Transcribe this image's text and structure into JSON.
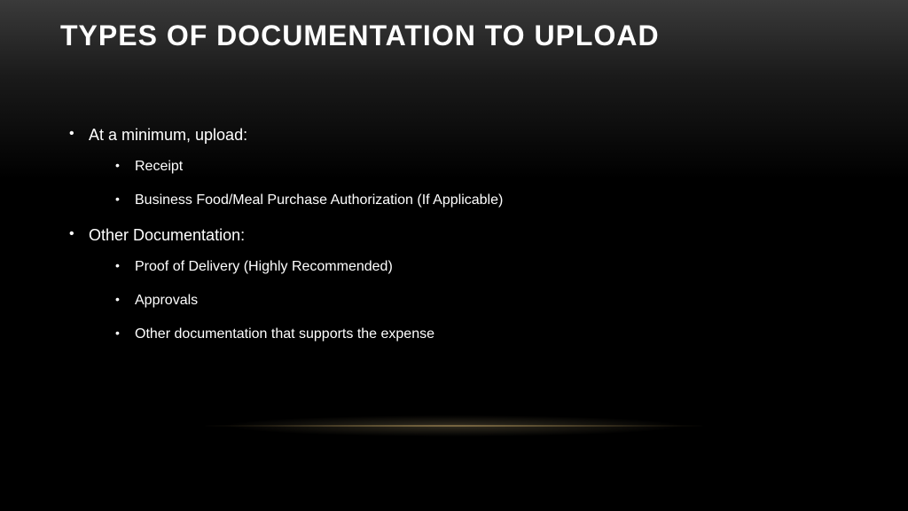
{
  "slide": {
    "title": "TYPES OF DOCUMENTATION TO UPLOAD",
    "bullets": [
      {
        "text": "At a minimum, upload:",
        "sub": [
          "Receipt",
          "Business Food/Meal Purchase Authorization (If Applicable)"
        ]
      },
      {
        "text": "Other Documentation:",
        "sub": [
          "Proof of Delivery (Highly Recommended)",
          "Approvals",
          "Other documentation that supports the expense"
        ]
      }
    ]
  }
}
